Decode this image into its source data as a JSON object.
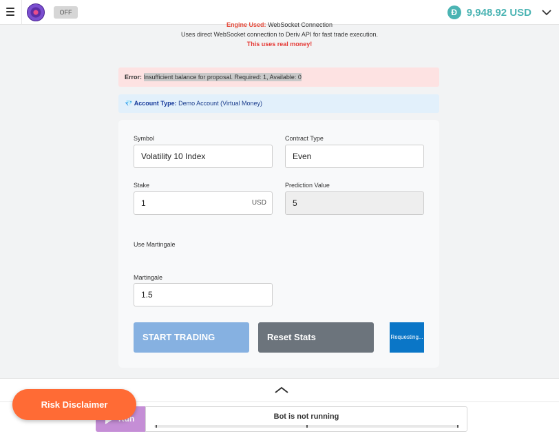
{
  "header": {
    "toggle_label": "OFF",
    "balance": "9,948.92 USD",
    "coin_glyph": "Đ",
    "accent_color": "#4bb4b3"
  },
  "info": {
    "engine_label": "Engine Used:",
    "engine_value": "WebSocket Connection",
    "description": "Uses direct WebSocket connection to Deriv API for fast trade execution.",
    "warning": "This uses real money!"
  },
  "alerts": {
    "error_label": "Error:",
    "error_message": "Insufficient balance for proposal. Required: 1, Available: 0",
    "account_icon": "💎",
    "account_label": "Account Type:",
    "account_value": "Demo Account (Virtual Money)"
  },
  "form": {
    "symbol_label": "Symbol",
    "symbol_value": "Volatility 10 Index",
    "contract_label": "Contract Type",
    "contract_value": "Even",
    "stake_label": "Stake",
    "stake_value": "1",
    "stake_currency": "USD",
    "prediction_label": "Prediction Value",
    "prediction_value": "5",
    "martingale_toggle_label": "Use Martingale",
    "martingale_label": "Martingale",
    "martingale_value": "1.5"
  },
  "buttons": {
    "start": "START TRADING",
    "reset": "Reset Stats",
    "requesting": "Requesting..."
  },
  "bottom": {
    "run_label": "Run",
    "status": "Bot is not running",
    "risk_disclaimer": "Risk Disclaimer"
  }
}
